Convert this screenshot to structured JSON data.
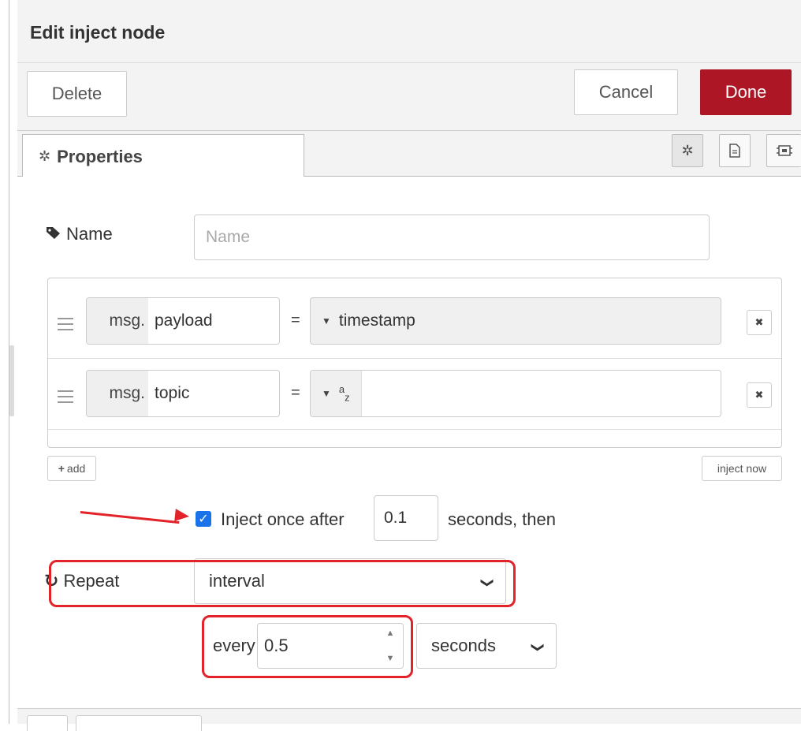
{
  "dialog": {
    "title": "Edit inject node",
    "delete_label": "Delete",
    "cancel_label": "Cancel",
    "done_label": "Done"
  },
  "tabs": {
    "properties_label": "Properties",
    "icons": [
      "gear-icon",
      "description-icon",
      "appearance-icon"
    ]
  },
  "name_field": {
    "label": "Name",
    "placeholder": "Name",
    "value": ""
  },
  "properties": [
    {
      "prefix": "msg.",
      "property": "payload",
      "type_label": "timestamp",
      "value": ""
    },
    {
      "prefix": "msg.",
      "property": "topic",
      "type_label": "az",
      "value": ""
    }
  ],
  "equals_sign": "=",
  "remove_symbol": "✖",
  "add_label": "add",
  "inject_now_label": "inject now",
  "inject_once": {
    "checked": true,
    "label": "Inject once after",
    "value": "0.1",
    "suffix": "seconds, then"
  },
  "repeat": {
    "label": "Repeat",
    "selected": "interval",
    "every_label": "every",
    "every_value": "0.5",
    "unit_selected": "seconds"
  },
  "colors": {
    "done_button": "#ad1625",
    "highlight": "#e2232a",
    "checkbox": "#1a73e8"
  }
}
